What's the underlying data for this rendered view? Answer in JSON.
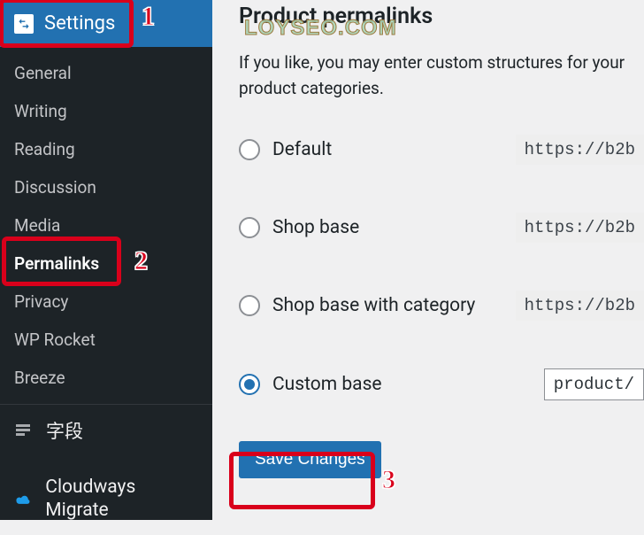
{
  "sidebar": {
    "header": {
      "label": "Settings",
      "icon": "settings-toggle-icon"
    },
    "items": [
      {
        "label": "General"
      },
      {
        "label": "Writing"
      },
      {
        "label": "Reading"
      },
      {
        "label": "Discussion"
      },
      {
        "label": "Media"
      },
      {
        "label": "Permalinks",
        "active": true
      },
      {
        "label": "Privacy"
      },
      {
        "label": "WP Rocket"
      },
      {
        "label": "Breeze"
      }
    ],
    "sections": [
      {
        "label": "字段",
        "icon": "fields-icon"
      },
      {
        "label": "Cloudways Migrate",
        "icon": "cloud-icon"
      }
    ]
  },
  "content": {
    "heading": "Product permalinks",
    "description": "If you like, you may enter custom structures for your product categories.",
    "options": [
      {
        "label": "Default",
        "url": "https://b2b",
        "checked": false
      },
      {
        "label": "Shop base",
        "url": "https://b2b",
        "checked": false
      },
      {
        "label": "Shop base with category",
        "url": "https://b2b",
        "checked": false
      },
      {
        "label": "Custom base",
        "input": "product/",
        "checked": true
      }
    ],
    "save_label": "Save Changes"
  },
  "annotations": {
    "1": "1",
    "2": "2",
    "3": "3"
  },
  "watermark": "LOYSEO.COM"
}
